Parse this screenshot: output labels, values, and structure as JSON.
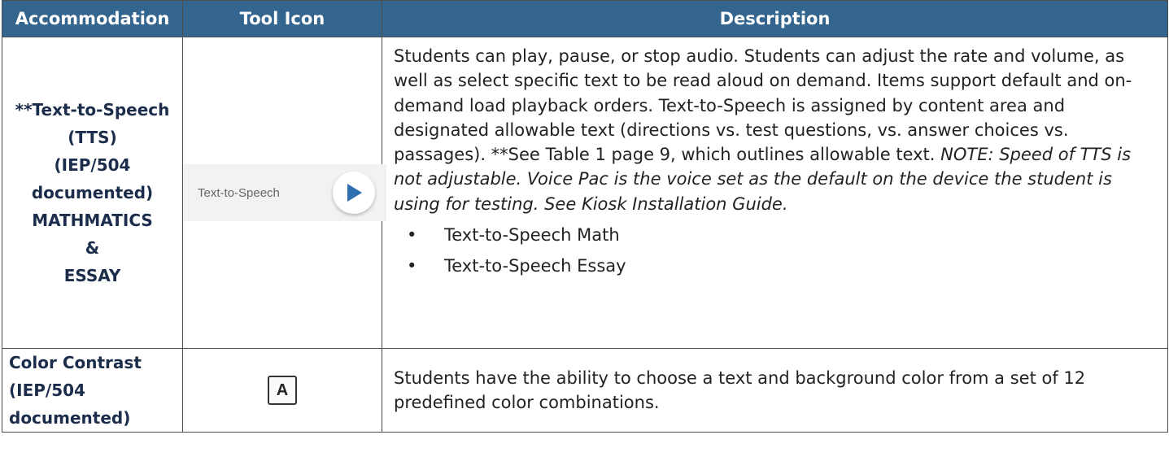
{
  "header": {
    "accommodation": "Accommodation",
    "tool_icon": "Tool Icon",
    "description": "Description"
  },
  "rows": [
    {
      "accommodation": {
        "line1": "**Text-to-Speech (TTS)",
        "line2": "(IEP/504 documented)",
        "line3": "MATHMATICS",
        "line4": "&",
        "line5": "ESSAY"
      },
      "icon": {
        "name": "text-to-speech-play-icon",
        "label": "Text-to-Speech",
        "accent": "#2f6fb0"
      },
      "description": {
        "text": "Students can play, pause, or stop audio. Students can adjust the rate and volume, as well as select specific text to be read aloud on demand. Items support default and on-demand load playback orders. Text-to-Speech is assigned by content area and designated allowable text (directions vs. test questions, vs. answer choices vs. passages). **See Table 1 page 9, which outlines allowable text. ",
        "note": "NOTE: Speed of TTS is not adjustable. Voice Pac is the voice set as the default on the device the student is using for testing. See Kiosk Installation Guide.",
        "bullets": [
          "Text-to-Speech Math",
          "Text-to-Speech Essay"
        ]
      }
    },
    {
      "accommodation": {
        "line1": "Color Contrast",
        "line2": "(IEP/504 documented)"
      },
      "icon": {
        "name": "color-contrast-icon",
        "label": "A"
      },
      "description": {
        "text": "Students have the ability to choose a text and background color from a set of 12 predefined color combinations."
      }
    }
  ],
  "colors": {
    "header_bg": "#34658f",
    "header_text": "#ffffff",
    "accommodation_text": "#1b2d4b",
    "border": "#4d4d4d"
  }
}
